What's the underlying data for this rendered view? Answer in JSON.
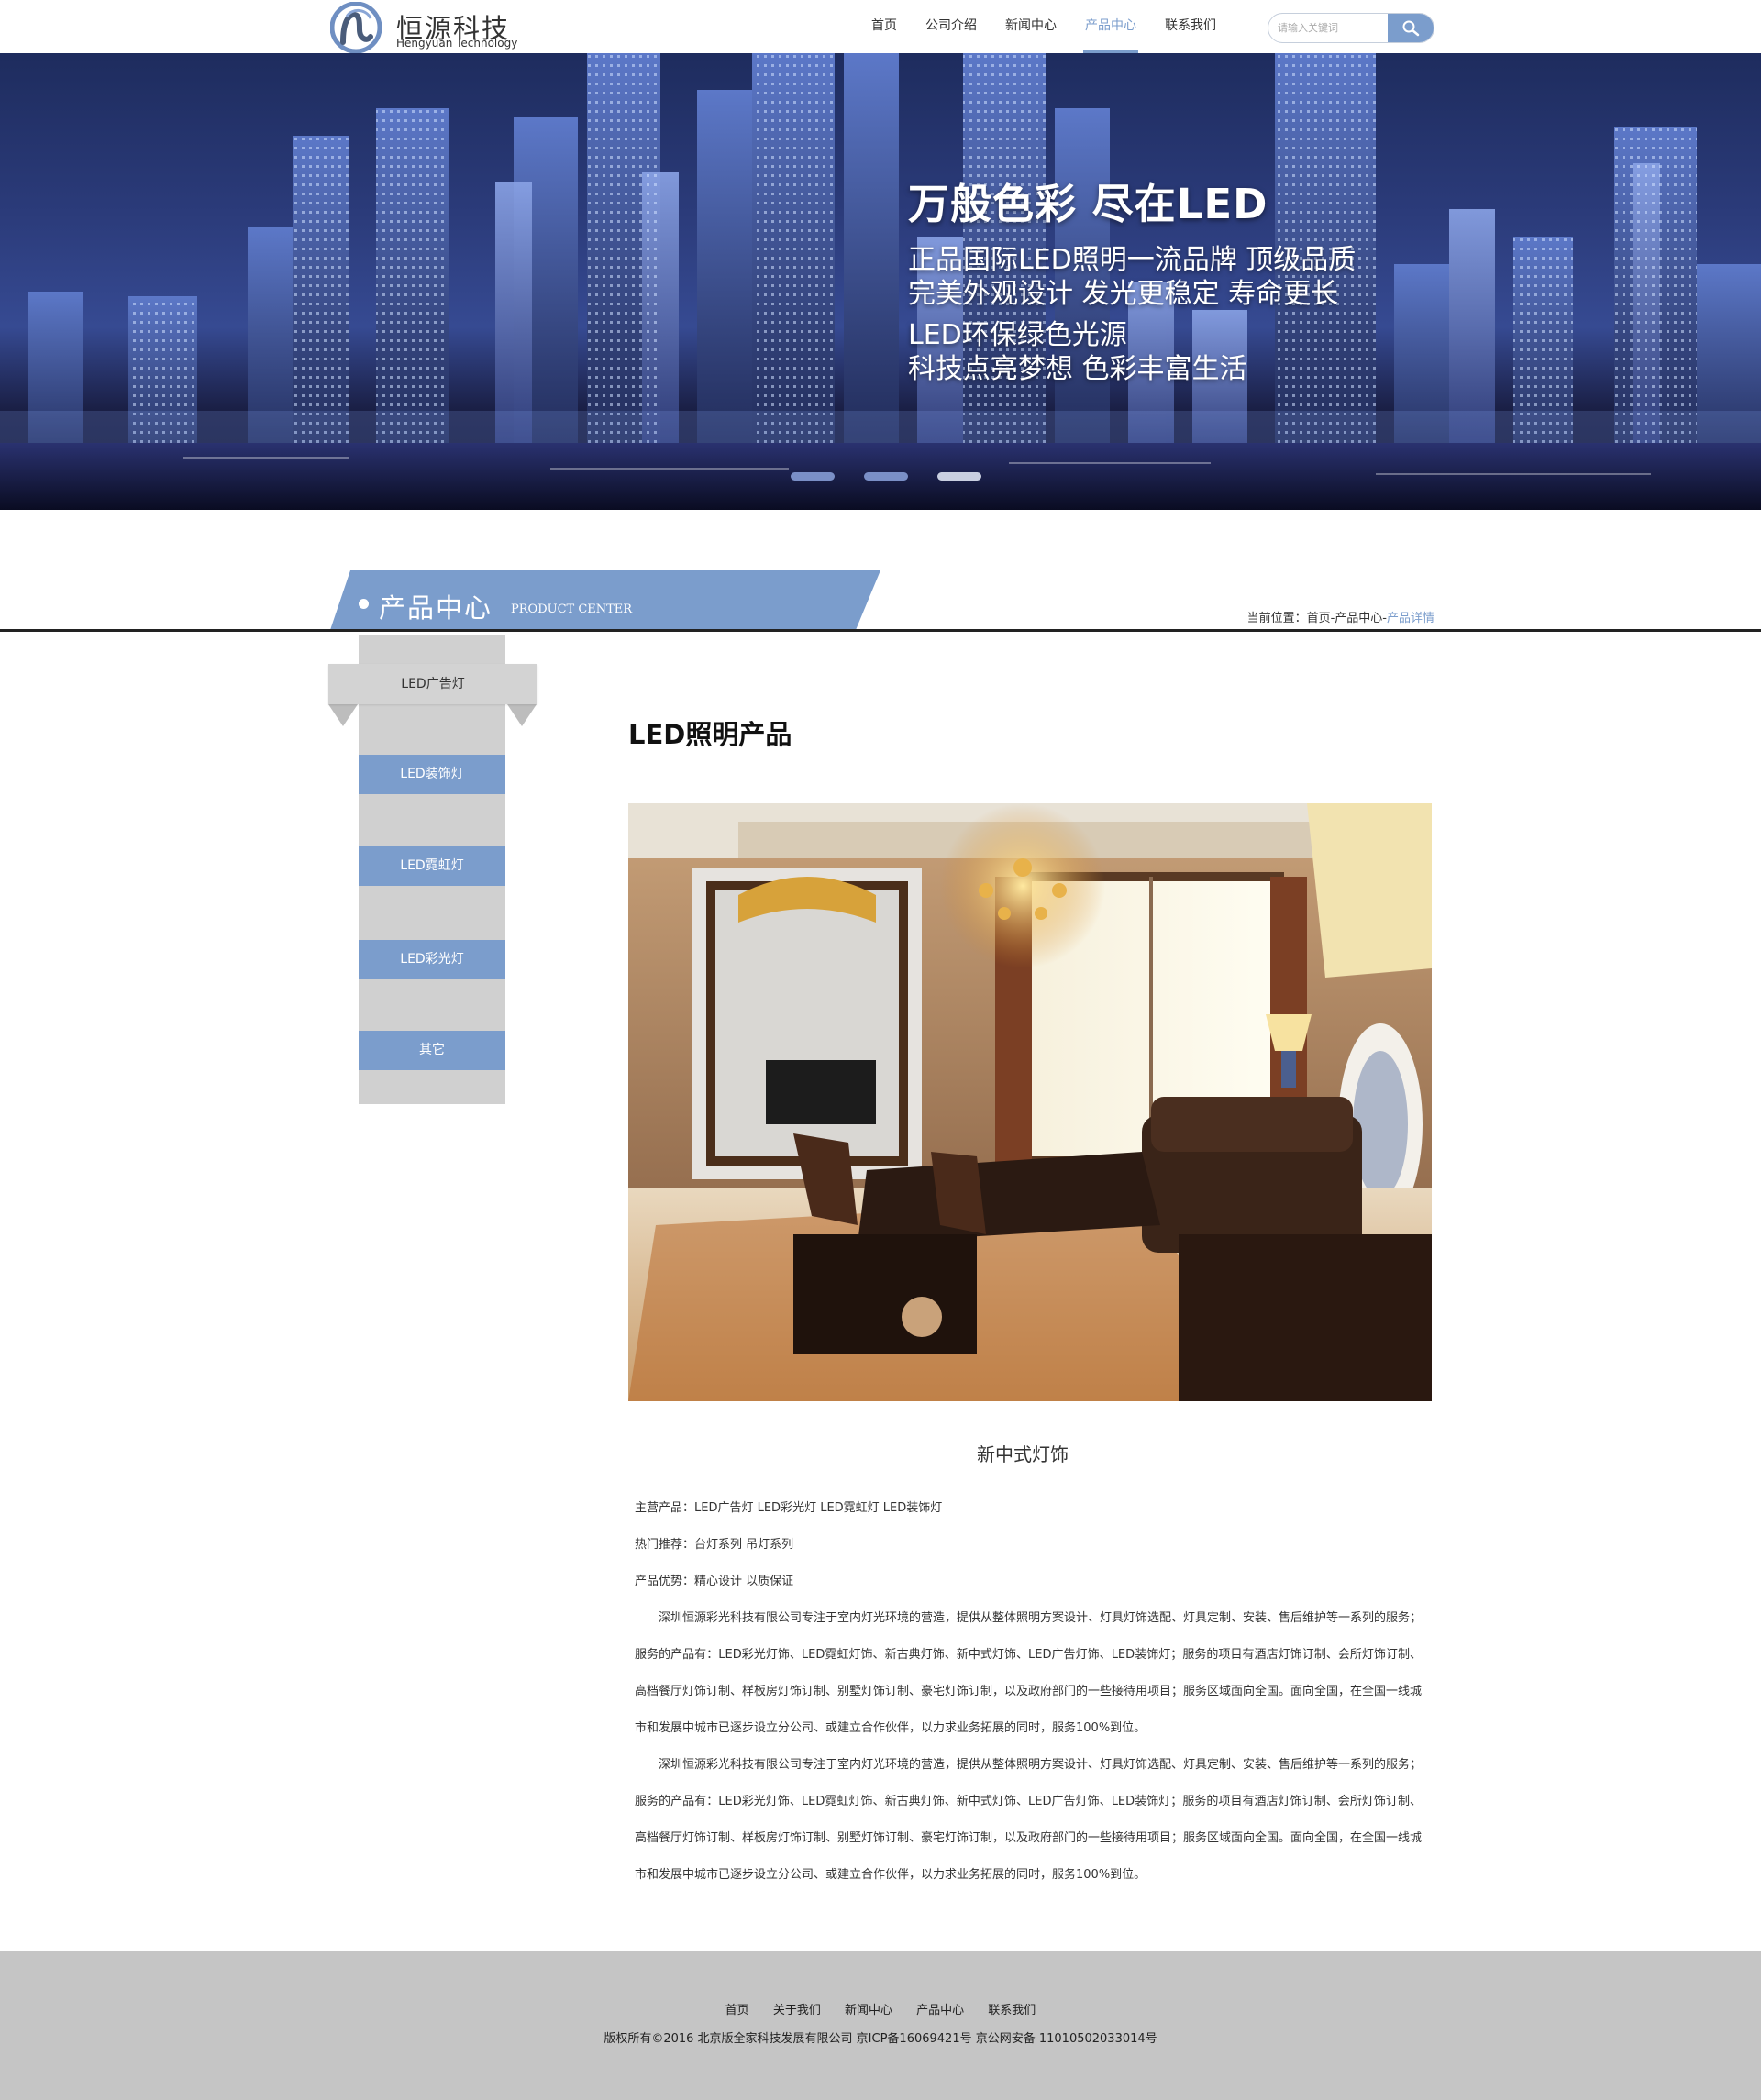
{
  "brand": {
    "name_cn": "恒源科技",
    "name_en": "Hengyuan Technology"
  },
  "nav": {
    "items": [
      {
        "label": "首页"
      },
      {
        "label": "公司介绍"
      },
      {
        "label": "新闻中心"
      },
      {
        "label": "产品中心",
        "active": true
      },
      {
        "label": "联系我们"
      }
    ]
  },
  "search": {
    "placeholder": "请输入关键词",
    "button_icon": "search-icon"
  },
  "banner": {
    "title": "万般色彩 尽在LED",
    "lines": [
      "正品国际LED照明一流品牌 顶级品质",
      "完美外观设计 发光更稳定 寿命更长",
      "LED环保绿色光源",
      "科技点亮梦想 色彩丰富生活"
    ],
    "slides": 3,
    "current_slide": 3
  },
  "section": {
    "title": "产品中心",
    "subtitle": "PRODUCT CENTER"
  },
  "breadcrumb": {
    "prefix": "当前位置：首页-产品中心-",
    "current": "产品详情"
  },
  "sidebar": {
    "header": "LED广告灯",
    "items": [
      {
        "label": "LED装饰灯"
      },
      {
        "label": "LED霓虹灯"
      },
      {
        "label": "LED彩光灯"
      },
      {
        "label": "其它"
      }
    ]
  },
  "product": {
    "heading": "LED照明产品",
    "caption": "新中式灯饰",
    "info": [
      "主营产品：LED广告灯  LED彩光灯  LED霓虹灯  LED装饰灯",
      "热门推荐：台灯系列  吊灯系列",
      "产品优势：精心设计  以质保证"
    ],
    "paragraphs": [
      "深圳恒源彩光科技有限公司专注于室内灯光环境的营造，提供从整体照明方案设计、灯具灯饰选配、灯具定制、安装、售后维护等一系列的服务；服务的产品有：LED彩光灯饰、LED霓虹灯饰、新古典灯饰、新中式灯饰、LED广告灯饰、LED装饰灯；服务的项目有酒店灯饰订制、会所灯饰订制、高档餐厅灯饰订制、样板房灯饰订制、别墅灯饰订制、豪宅灯饰订制，以及政府部门的一些接待用项目；服务区域面向全国。面向全国，在全国一线城市和发展中城市已逐步设立分公司、或建立合作伙伴，以力求业务拓展的同时，服务100%到位。",
      "深圳恒源彩光科技有限公司专注于室内灯光环境的营造，提供从整体照明方案设计、灯具灯饰选配、灯具定制、安装、售后维护等一系列的服务；服务的产品有：LED彩光灯饰、LED霓虹灯饰、新古典灯饰、新中式灯饰、LED广告灯饰、LED装饰灯；服务的项目有酒店灯饰订制、会所灯饰订制、高档餐厅灯饰订制、样板房灯饰订制、别墅灯饰订制、豪宅灯饰订制，以及政府部门的一些接待用项目；服务区域面向全国。面向全国，在全国一线城市和发展中城市已逐步设立分公司、或建立合作伙伴，以力求业务拓展的同时，服务100%到位。"
    ]
  },
  "footer": {
    "links": [
      {
        "label": "首页"
      },
      {
        "label": "关于我们"
      },
      {
        "label": "新闻中心"
      },
      {
        "label": "产品中心"
      },
      {
        "label": "联系我们"
      }
    ],
    "copyright": "版权所有©2016  北京版全家科技发展有限公司  京ICP备16069421号    京公网安备  11010502033014号"
  },
  "colors": {
    "accent": "#7b9dcc",
    "sidebar_gray": "#d0d0d0",
    "footer_gray": "#c5c5c5"
  }
}
